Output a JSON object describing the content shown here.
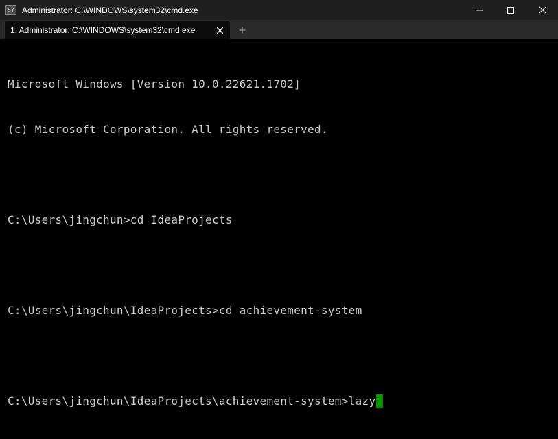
{
  "window": {
    "title": "Administrator: C:\\WINDOWS\\system32\\cmd.exe",
    "app_icon_text": "SY",
    "controls": [
      "minimize",
      "maximize",
      "close"
    ]
  },
  "tabs": [
    {
      "label": "1: Administrator: C:\\WINDOWS\\system32\\cmd.exe",
      "active": true
    }
  ],
  "terminal": {
    "lines": [
      "Microsoft Windows [Version 10.0.22621.1702]",
      "(c) Microsoft Corporation. All rights reserved.",
      "",
      "C:\\Users\\jingchun>cd IdeaProjects",
      "",
      "C:\\Users\\jingchun\\IdeaProjects>cd achievement-system",
      ""
    ],
    "current_prompt": "C:\\Users\\jingchun\\IdeaProjects\\achievement-system>lazy",
    "cursor_color": "#16c60c",
    "text_color": "#cccccc",
    "background": "#000000"
  },
  "icons": {
    "minimize": "minimize-icon",
    "maximize": "maximize-icon",
    "close": "close-icon",
    "tab_close": "close-icon",
    "new_tab": "plus-icon"
  }
}
